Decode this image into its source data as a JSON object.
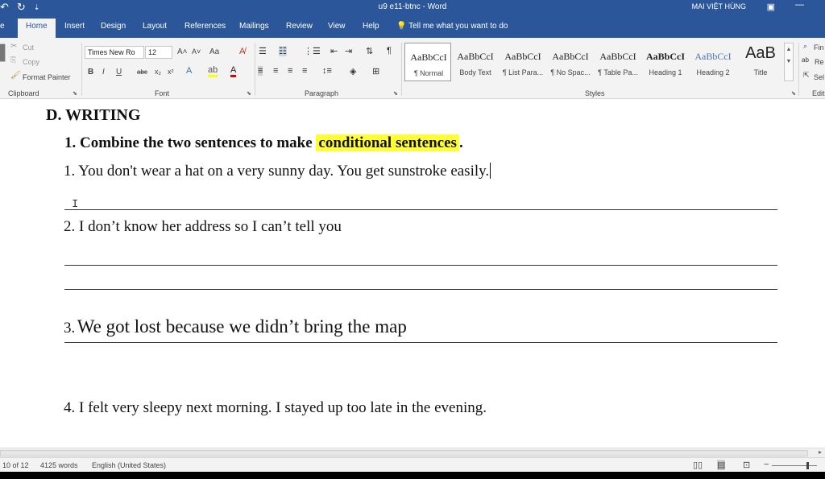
{
  "titlebar": {
    "doc_title": "u9 e11-btnc  -  Word",
    "user": "MAI VIỆT HÙNG",
    "qat_undo": "↶",
    "qat_redo": "↻",
    "qat_more": "⇣"
  },
  "tabs": [
    {
      "label": "Home"
    },
    {
      "label": "Insert"
    },
    {
      "label": "Design"
    },
    {
      "label": "Layout"
    },
    {
      "label": "References"
    },
    {
      "label": "Mailings"
    },
    {
      "label": "Review"
    },
    {
      "label": "View"
    },
    {
      "label": "Help"
    }
  ],
  "tell_me": "Tell me what you want to do",
  "clipboard": {
    "cut": "Cut",
    "copy": "Copy",
    "format_painter": "Format Painter",
    "label": "Clipboard"
  },
  "font": {
    "name": "Times New Ro",
    "size": "12",
    "label": "Font",
    "grow": "A˄",
    "shrink": "A˅",
    "case": "Aa",
    "bold": "B",
    "italic": "I",
    "underline": "U",
    "strike": "abc",
    "sub": "x₂",
    "sup": "x²"
  },
  "paragraph": {
    "label": "Paragraph"
  },
  "styles": {
    "label": "Styles",
    "items": [
      {
        "preview": "AaBbCcI",
        "name": "¶ Normal"
      },
      {
        "preview": "AaBbCcI",
        "name": "Body Text"
      },
      {
        "preview": "AaBbCcI",
        "name": "¶ List Para..."
      },
      {
        "preview": "AaBbCcI",
        "name": "¶ No Spac..."
      },
      {
        "preview": "AaBbCcI",
        "name": "¶ Table Pa..."
      },
      {
        "preview": "AaBbCcI",
        "name": "Heading 1"
      },
      {
        "preview": "AaBbCcI",
        "name": "Heading 2"
      },
      {
        "preview": "AaB",
        "name": "Title"
      }
    ]
  },
  "editing": {
    "find": "Fin",
    "replace": "Re",
    "select": "Sel",
    "label": "Edit"
  },
  "document": {
    "section_heading": "D. WRITING",
    "instruction_prefix": "1. Combine the two sentences to make",
    "instruction_highlight": "conditional sentences",
    "instruction_suffix": ".",
    "q1": "1. You don't wear a hat on a very sunny day. You get sunstroke easily.",
    "q2": "2. I don’t know her address so I can’t tell you",
    "q3_num": "3.",
    "q3_text": "We got lost because we didn’t bring the map",
    "q4": "4. I felt very sleepy next morning. I stayed up too late in the evening."
  },
  "status": {
    "page": "10 of 12",
    "words": "4125 words",
    "language": "English (United States)"
  },
  "colors": {
    "word_blue": "#2b579a",
    "highlight": "#ffff33",
    "ribbon_bg": "#f3f3f3"
  }
}
